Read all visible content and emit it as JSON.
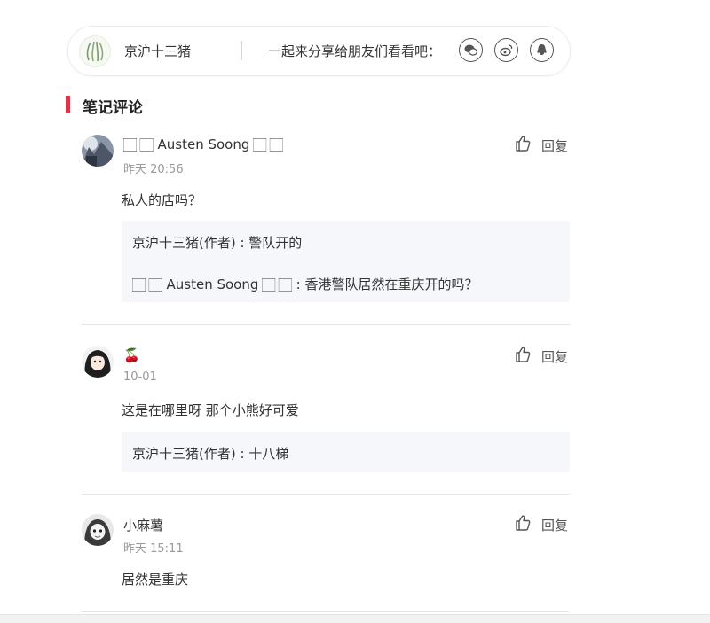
{
  "share_bar": {
    "author_name": "京沪十三猪",
    "share_text": "一起来分享给朋友们看看吧：",
    "icons": [
      "wechat-icon",
      "weibo-icon",
      "qq-icon"
    ]
  },
  "section": {
    "title": "笔记评论",
    "accent_color": "#e2324a"
  },
  "comments": [
    {
      "name": "🏻 🏻 Austen Soong 🏻 🏻",
      "time": "昨天 20:56",
      "text": "私人的店吗？",
      "reply_label": "回复",
      "replies": [
        "京沪十三猪(作者) : 警队开的",
        "🏻 🏻 Austen Soong 🏻 🏻 : 香港警队居然在重庆开的吗？"
      ]
    },
    {
      "name": "🍒",
      "time": "10-01",
      "text": "这是在哪里呀 那个小熊好可爱",
      "reply_label": "回复",
      "replies": [
        "京沪十三猪(作者) : 十八梯"
      ]
    },
    {
      "name": "小麻薯",
      "time": "昨天 15:11",
      "text": "居然是重庆",
      "reply_label": "回复",
      "replies": []
    }
  ]
}
